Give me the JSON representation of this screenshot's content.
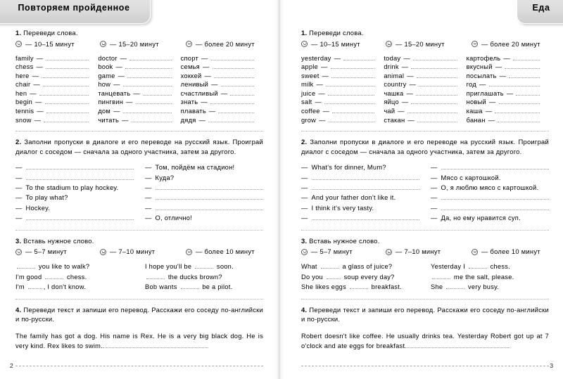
{
  "pages": [
    {
      "tab_label": "Повторяем пройденное",
      "page_number": "2",
      "task1": {
        "heading_num": "1.",
        "heading_text": "Переведи слова.",
        "legend": [
          {
            "icon": "smiley-happy-icon",
            "text": "— 10–15 минут"
          },
          {
            "icon": "smiley-neutral-icon",
            "text": "— 15–20 минут"
          },
          {
            "icon": "smiley-sad-icon",
            "text": "— более 20 минут"
          }
        ],
        "columns": [
          [
            "family",
            "chess",
            "here",
            "chair",
            "hen",
            "begin",
            "tennis",
            "snow"
          ],
          [
            "doctor",
            "book",
            "game",
            "how",
            "танцевать",
            "пингвин",
            "дом",
            "читать"
          ],
          [
            "спорт",
            "семья",
            "хоккей",
            "ленивый",
            "счастливый",
            "знать",
            "плавать",
            "дядя"
          ]
        ]
      },
      "task2": {
        "heading_num": "2.",
        "heading_text": "Заполни пропуски в диалоге и его переводе на русский язык. Проиграй диалог с соседом — сначала за одного участника, затем за другого.",
        "left_lines": [
          "",
          "",
          "To the stadium to play hockey.",
          "To play what?",
          "Hockey.",
          ""
        ],
        "right_lines": [
          "Том, пойдём на стадион!",
          "Куда?",
          "",
          "",
          "",
          "О, отлично!"
        ]
      },
      "task3": {
        "heading_num": "3.",
        "heading_text": "Вставь нужное слово.",
        "legend": [
          {
            "icon": "smiley-happy-icon",
            "text": "— 5–7 минут"
          },
          {
            "icon": "smiley-neutral-icon",
            "text": "— 7–10 минут"
          },
          {
            "icon": "smiley-sad-icon",
            "text": "— более 10 минут"
          }
        ],
        "left_lines": [
          [
            {
              "t": "gap"
            },
            {
              "t": "txt",
              "v": " you like to walk?"
            }
          ],
          [
            {
              "t": "txt",
              "v": "I'm good "
            },
            {
              "t": "gap"
            },
            {
              "t": "txt",
              "v": " chess."
            }
          ],
          [
            {
              "t": "txt",
              "v": "I'm "
            },
            {
              "t": "gap",
              "sm": true
            },
            {
              "t": "txt",
              "v": ", I don't know."
            }
          ]
        ],
        "right_lines": [
          [
            {
              "t": "txt",
              "v": "I hope you'll be "
            },
            {
              "t": "gap"
            },
            {
              "t": "txt",
              "v": " soon."
            }
          ],
          [
            {
              "t": "gap"
            },
            {
              "t": "txt",
              "v": " the ducks brown?"
            }
          ],
          [
            {
              "t": "txt",
              "v": "Bob wants "
            },
            {
              "t": "gap"
            },
            {
              "t": "txt",
              "v": " be a pilot."
            }
          ]
        ]
      },
      "task4": {
        "heading_num": "4.",
        "heading_text": "Переведи текст и запиши его перевод. Расскажи его соседу по-английски и по-русски.",
        "text": "The family has got a dog. His name is Rex. He is a very big black dog. He is very kind. Rex likes to swim."
      }
    },
    {
      "tab_label": "Еда",
      "page_number": "3",
      "task1": {
        "heading_num": "1.",
        "heading_text": "Переведи слова.",
        "legend": [
          {
            "icon": "smiley-happy-icon",
            "text": "— 10–15 минут"
          },
          {
            "icon": "smiley-neutral-icon",
            "text": "— 15–20 минут"
          },
          {
            "icon": "smiley-sad-icon",
            "text": "— более 20 минут"
          }
        ],
        "columns": [
          [
            "yesterday",
            "apple",
            "sweet",
            "milk",
            "juice",
            "salt",
            "coffee",
            "grow"
          ],
          [
            "today",
            "drink",
            "animal",
            "country",
            "чашка",
            "яйцо",
            "чай",
            "стакан"
          ],
          [
            "картофель",
            "вкусный",
            "посылать",
            "год",
            "приглашать",
            "новый",
            "каша",
            "банан"
          ]
        ]
      },
      "task2": {
        "heading_num": "2.",
        "heading_text": "Заполни пропуски в диалоге и его переводе на русский язык. Проиграй диалог с соседом — сначала за одного участника, затем за другого.",
        "left_lines": [
          "What's for dinner, Mum?",
          "",
          "",
          "And your father don't like it.",
          "I think it's very tasty.",
          ""
        ],
        "right_lines": [
          "",
          "Мясо с картошкой.",
          "О, я люблю мясо с картошкой.",
          "",
          "",
          "Да, но ему нравится суп."
        ]
      },
      "task3": {
        "heading_num": "3.",
        "heading_text": "Вставь нужное слово.",
        "legend": [
          {
            "icon": "smiley-happy-icon",
            "text": "— 5–7 минут"
          },
          {
            "icon": "smiley-neutral-icon",
            "text": "— 7–10 минут"
          },
          {
            "icon": "smiley-sad-icon",
            "text": "— более 10 минут"
          }
        ],
        "left_lines": [
          [
            {
              "t": "txt",
              "v": "What "
            },
            {
              "t": "gap"
            },
            {
              "t": "txt",
              "v": " a glass of juice?"
            }
          ],
          [
            {
              "t": "txt",
              "v": "Do you "
            },
            {
              "t": "gap",
              "sm": true
            },
            {
              "t": "txt",
              "v": " soup every day?"
            }
          ],
          [
            {
              "t": "txt",
              "v": "She likes eggs "
            },
            {
              "t": "gap"
            },
            {
              "t": "txt",
              "v": " breakfast."
            }
          ]
        ],
        "right_lines": [
          [
            {
              "t": "txt",
              "v": "Yesterday I "
            },
            {
              "t": "gap"
            },
            {
              "t": "txt",
              "v": " chess."
            }
          ],
          [
            {
              "t": "gap"
            },
            {
              "t": "txt",
              "v": " me the salt, please."
            }
          ],
          [
            {
              "t": "txt",
              "v": "She "
            },
            {
              "t": "gap"
            },
            {
              "t": "txt",
              "v": " very busy."
            }
          ]
        ]
      },
      "task4": {
        "heading_num": "4.",
        "heading_text": "Переведи текст и запиши его перевод. Расскажи его соседу по-английски и по-русски.",
        "text": "Robert doesn't like coffee. He usually drinks tea. Yesterday Robert got up at 7 o'clock and ate eggs for breakfast"
      }
    }
  ],
  "colors": {
    "tab_bg": "#dcdcdc",
    "dotted_rule": "#9a9a9a",
    "page_bg": "#ffffff",
    "text": "#000000"
  }
}
